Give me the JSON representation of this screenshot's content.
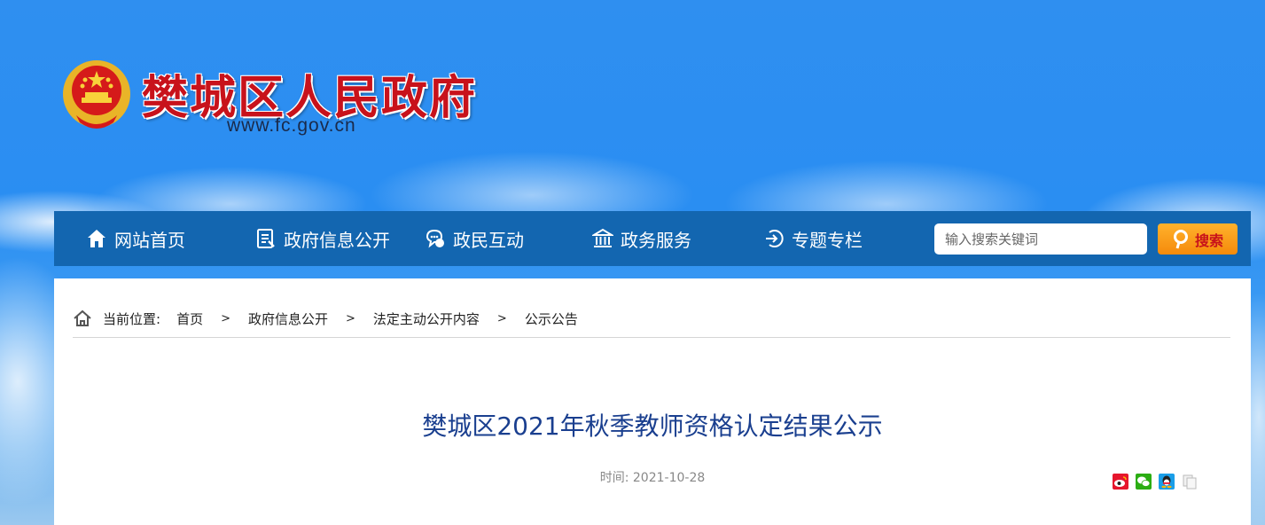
{
  "header": {
    "title": "樊城区人民政府",
    "url": "www.fc.gov.cn"
  },
  "nav": {
    "items": [
      {
        "label": "网站首页",
        "icon": "home-icon"
      },
      {
        "label": "政府信息公开",
        "icon": "document-list-icon"
      },
      {
        "label": "政民互动",
        "icon": "chat-bubble-icon"
      },
      {
        "label": "政务服务",
        "icon": "government-building-icon"
      },
      {
        "label": "专题专栏",
        "icon": "enter-arrow-icon"
      }
    ],
    "search_placeholder": "输入搜索关键词",
    "search_label": "搜索"
  },
  "breadcrumb": {
    "label": "当前位置:",
    "items": [
      "首页",
      "政府信息公开",
      "法定主动公开内容",
      "公示公告"
    ],
    "separator": ">"
  },
  "article": {
    "title": "樊城区2021年秋季教师资格认定结果公示",
    "date": "时间: 2021-10-28"
  },
  "share": [
    "weibo-icon",
    "wechat-icon",
    "qq-icon",
    "copy-icon"
  ],
  "colors": {
    "brand_red": "#c8121b",
    "nav_blue": "#1366b0",
    "title_blue": "#1a3f8f",
    "search_orange": "#f58a0b"
  }
}
